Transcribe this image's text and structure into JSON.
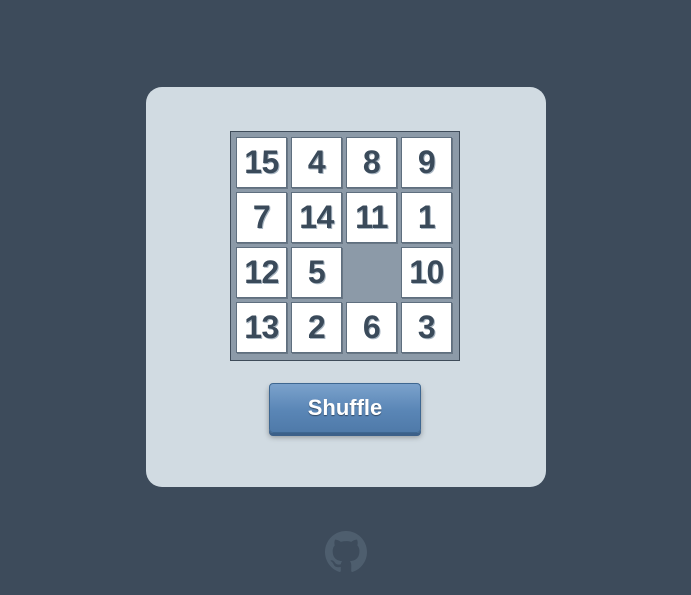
{
  "game": {
    "board": {
      "size": 4,
      "tiles": [
        "15",
        "4",
        "8",
        "9",
        "7",
        "14",
        "11",
        "1",
        "12",
        "5",
        "",
        "10",
        "13",
        "2",
        "6",
        "3"
      ]
    },
    "shuffle_label": "Shuffle"
  },
  "footer": {
    "icon": "github-icon"
  },
  "colors": {
    "background": "#3d4b5b",
    "card": "#d1dbe2",
    "board": "#8c9aa8",
    "tile": "#ffffff",
    "tile_text": "#3a4a5a",
    "button": "#5a86b6",
    "icon": "#4e5e6e"
  }
}
